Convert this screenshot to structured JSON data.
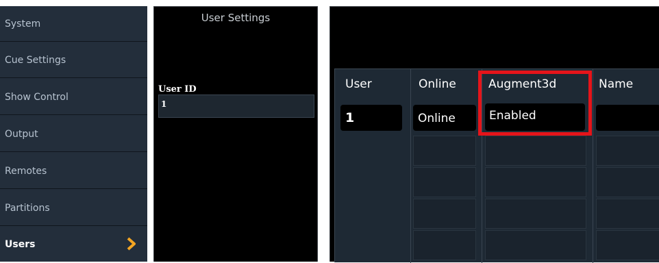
{
  "sidebar": {
    "items": [
      {
        "label": "System"
      },
      {
        "label": "Cue Settings"
      },
      {
        "label": "Show Control"
      },
      {
        "label": "Output"
      },
      {
        "label": "Remotes"
      },
      {
        "label": "Partitions"
      },
      {
        "label": "Users",
        "active": true
      }
    ],
    "active_arrow_color": "#f5a623"
  },
  "user_settings": {
    "title": "User Settings",
    "user_id_label": "User ID",
    "user_id_value": "1"
  },
  "user_table": {
    "headers": [
      "User",
      "Online",
      "Augment3d",
      "Name"
    ],
    "rows": [
      {
        "user": "1",
        "online": "Online",
        "augment3d": "Enabled",
        "name": ""
      }
    ],
    "highlight_color": "#e5141a"
  }
}
